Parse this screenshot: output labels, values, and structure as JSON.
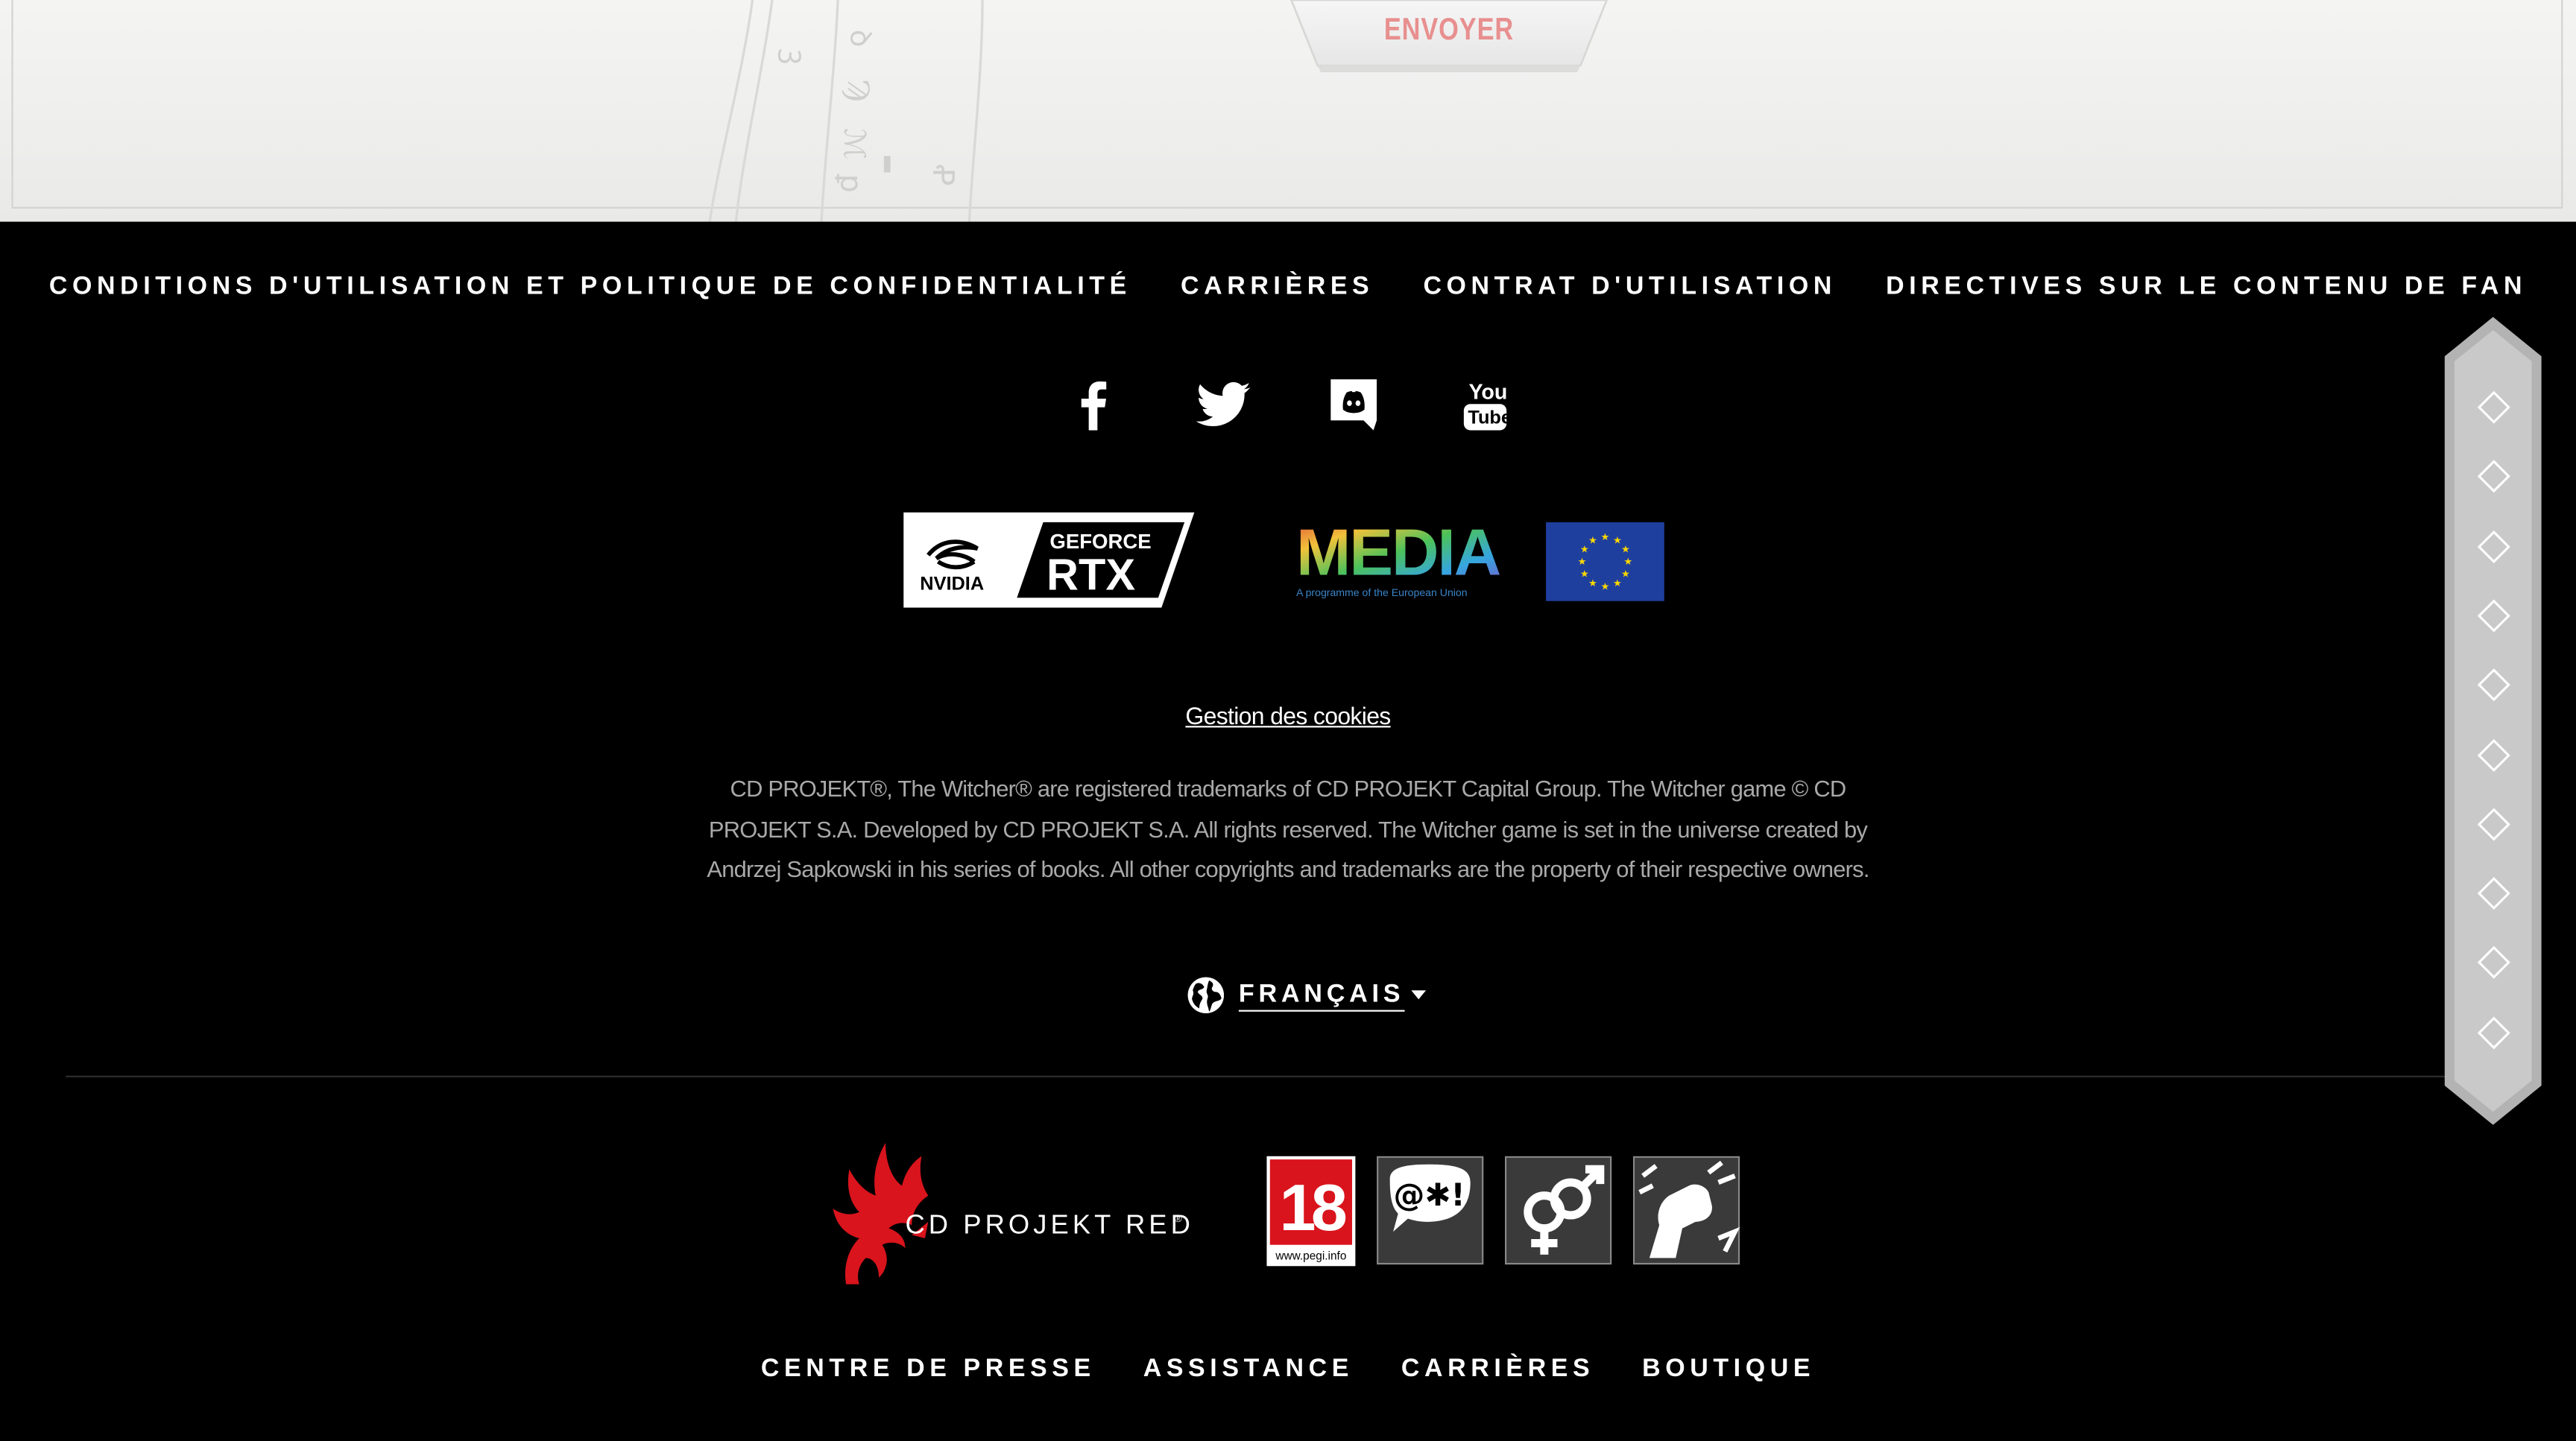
{
  "form": {
    "submit_label": "ENVOYER"
  },
  "footer_nav": [
    "CONDITIONS D'UTILISATION ET POLITIQUE DE CONFIDENTIALITÉ",
    "CARRIÈRES",
    "CONTRAT D'UTILISATION",
    "DIRECTIVES SUR LE CONTENU DE FAN"
  ],
  "social": [
    "facebook-icon",
    "twitter-icon",
    "discord-icon",
    "youtube-icon"
  ],
  "partners": {
    "nvidia": {
      "brand": "NVIDIA",
      "line1": "GEFORCE",
      "line2": "RTX"
    },
    "media": {
      "title": "MEDIA",
      "subtitle": "A programme of the European Union"
    }
  },
  "cookies_link": "Gestion des cookies",
  "legal_text": "CD PROJEKT®, The Witcher® are registered trademarks of CD PROJEKT Capital Group. The Witcher game © CD PROJEKT S.A. Developed by CD PROJEKT S.A. All rights reserved. The Witcher game is set in the universe created by Andrzej Sapkowski in his series of books. All other copyrights and trademarks are the property of their respective owners.",
  "language": {
    "current": "FRANÇAIS"
  },
  "side_nav_count": 10,
  "brand": {
    "name": "CD PROJEKT RED"
  },
  "pegi": {
    "age": "18",
    "site": "www.pegi.info",
    "descriptors": [
      "bad-language-icon",
      "sex-icon",
      "violence-icon"
    ]
  },
  "bottom_nav": [
    "CENTRE DE PRESSE",
    "ASSISTANCE",
    "CARRIÈRES",
    "BOUTIQUE"
  ],
  "colors": {
    "background": "#000000",
    "brand_red": "#d9141c",
    "submit_text": "#e88f8f",
    "eu_blue": "#1f3f9e",
    "eu_gold": "#ffd800"
  }
}
